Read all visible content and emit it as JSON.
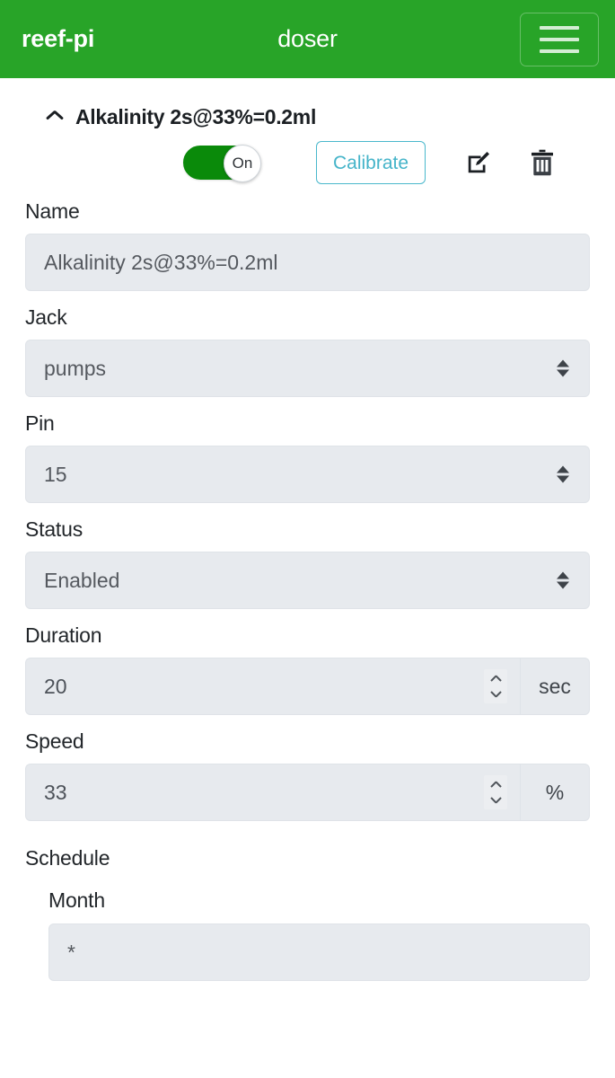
{
  "navbar": {
    "brand": "reef-pi",
    "title": "doser",
    "menu_icon": "hamburger-menu-icon",
    "background_color": "#28a428"
  },
  "item": {
    "collapse_icon": "chevron-up-icon",
    "title": "Alkalinity 2s@33%=0.2ml",
    "toggle": {
      "label": "On",
      "state": "on",
      "color": "#0a8a0a"
    },
    "calibrate_label": "Calibrate",
    "calibrate_color": "#4ab8cc",
    "edit_icon": "edit-pencil-icon",
    "delete_icon": "trash-icon"
  },
  "form": {
    "name": {
      "label": "Name",
      "value": "Alkalinity 2s@33%=0.2ml"
    },
    "jack": {
      "label": "Jack",
      "value": "pumps"
    },
    "pin": {
      "label": "Pin",
      "value": "15"
    },
    "status": {
      "label": "Status",
      "value": "Enabled"
    },
    "duration": {
      "label": "Duration",
      "value": "20",
      "unit": "sec"
    },
    "speed": {
      "label": "Speed",
      "value": "33",
      "unit": "%"
    }
  },
  "schedule": {
    "heading": "Schedule",
    "month": {
      "label": "Month",
      "value": "*"
    }
  }
}
